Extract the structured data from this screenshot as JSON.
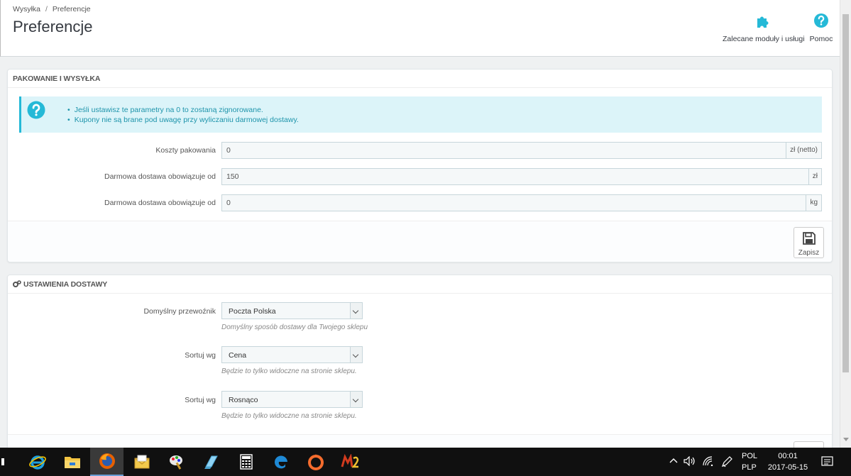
{
  "breadcrumb": {
    "parent": "Wysyłka",
    "separator": "/",
    "current": "Preferencje"
  },
  "page_title": "Preferencje",
  "toolbar": {
    "modules_label": "Zalecane moduły i usługi",
    "help_label": "Pomoc"
  },
  "colors": {
    "accent": "#25b9d7",
    "alert_bg": "#dcf4f9",
    "alert_text": "#1e94ab"
  },
  "panel_packaging": {
    "heading": "PAKOWANIE I WYSYŁKA",
    "alert_items": [
      "Jeśli ustawisz te parametry na 0 to zostaną zignorowane.",
      "Kupony nie są brane pod uwagę przy wyliczaniu darmowej dostawy."
    ],
    "fields": [
      {
        "label": "Koszty pakowania",
        "value": "0",
        "addon": "zł (netto)"
      },
      {
        "label": "Darmowa dostawa obowiązuje od",
        "value": "150",
        "addon": "zł"
      },
      {
        "label": "Darmowa dostawa obowiązuje od",
        "value": "0",
        "addon": "kg"
      }
    ],
    "save_label": "Zapisz"
  },
  "panel_delivery": {
    "heading": "USTAWIENIA DOSTAWY",
    "fields": [
      {
        "label": "Domyślny przewoźnik",
        "value": "Poczta Polska",
        "help": "Domyślny sposób dostawy dla Twojego sklepu"
      },
      {
        "label": "Sortuj wg",
        "value": "Cena",
        "help": "Będzie to tylko widoczne na stronie sklepu."
      },
      {
        "label": "Sortuj wg",
        "value": "Rosnąco",
        "help": "Będzie to tylko widoczne na stronie sklepu."
      }
    ]
  },
  "taskbar": {
    "apps": [
      "internet-explorer",
      "file-explorer",
      "firefox",
      "mail",
      "paint",
      "notepad",
      "calculator",
      "edge",
      "origin",
      "metin2"
    ],
    "language": "POL",
    "keyboard": "PLP",
    "time": "00:01",
    "date": "2017-05-15"
  }
}
